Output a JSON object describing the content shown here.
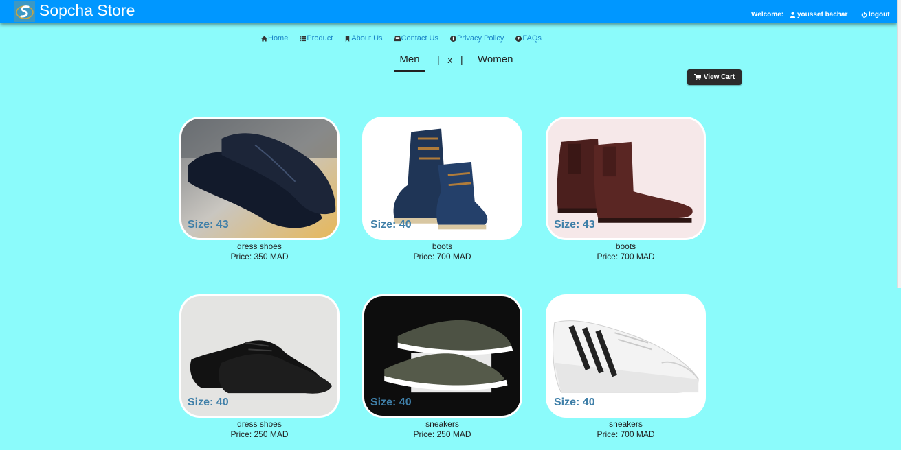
{
  "header": {
    "brand": "Sopcha Store",
    "welcome_label": "Welcome:",
    "user_name": "youssef bachar",
    "logout_label": "logout",
    "accent_color": "#0097ff"
  },
  "nav": {
    "items": [
      {
        "label": "Home",
        "icon": "home-icon"
      },
      {
        "label": "Product",
        "icon": "list-icon"
      },
      {
        "label": "About Us",
        "icon": "bookmark-icon"
      },
      {
        "label": "Contact Us",
        "icon": "inbox-icon"
      },
      {
        "label": "Privacy Policy",
        "icon": "info-icon"
      },
      {
        "label": "FAQs",
        "icon": "question-icon"
      }
    ]
  },
  "tabs": {
    "men": "Men",
    "separator": "|   x   |",
    "women": "Women"
  },
  "cart": {
    "label": "View Cart",
    "icon": "cart-icon"
  },
  "products": [
    {
      "name": "dress shoes",
      "price": "Price: 350 MAD",
      "size": "Size: 43"
    },
    {
      "name": "boots",
      "price": "Price: 700 MAD",
      "size": "Size: 40"
    },
    {
      "name": "boots",
      "price": "Price: 700 MAD",
      "size": "Size: 43"
    },
    {
      "name": "dress shoes",
      "price": "Price: 250 MAD",
      "size": "Size: 40"
    },
    {
      "name": "sneakers",
      "price": "Price: 250 MAD",
      "size": "Size: 40"
    },
    {
      "name": "sneakers",
      "price": "Price: 700 MAD",
      "size": "Size: 40"
    }
  ]
}
